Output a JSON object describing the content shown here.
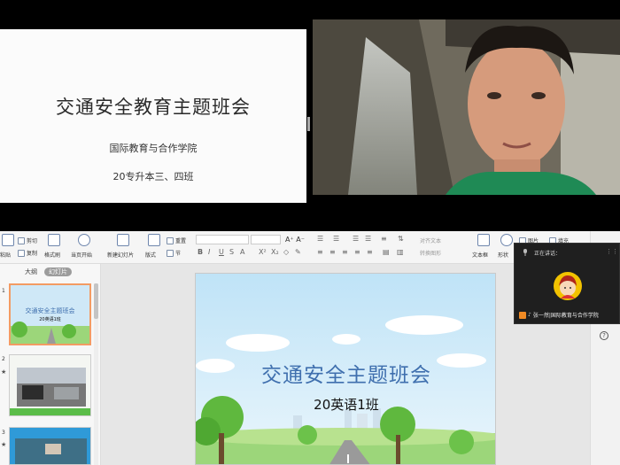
{
  "shared_slide": {
    "title": "交通安全教育主题班会",
    "subtitle": "国际教育与合作学院",
    "class_line": "20专升本三、四班"
  },
  "ribbon": {
    "paste": "粘贴",
    "cut": "剪切",
    "copy": "复制",
    "format_painter": "格式刷",
    "start_from_current": "当页开始",
    "new_slide": "新建幻灯片",
    "layout": "版式",
    "reset": "重置",
    "section": "节",
    "align_text": "对齐文本",
    "convert_smartart": "转换图形",
    "textbox": "文本框",
    "shape": "形状",
    "picture": "图片",
    "fill": "填充"
  },
  "left_panel": {
    "tab_outline": "大纲",
    "tab_slides": "幻灯片",
    "thumbnails": [
      {
        "num": "1",
        "title": "交通安全主题班会",
        "sub": "20英语1班"
      },
      {
        "num": "2",
        "star": "★"
      },
      {
        "num": "3",
        "star": "★"
      }
    ]
  },
  "main_slide": {
    "title": "交通安全主题班会",
    "subtitle": "20英语1班"
  },
  "meeting": {
    "status": "正在讲话：",
    "participant": "张一然|国际教育与合作学院"
  },
  "colors": {
    "slide_title": "#3f6fae",
    "active_thumb_border": "#f39b63",
    "participant_badge": "#f08a24"
  }
}
